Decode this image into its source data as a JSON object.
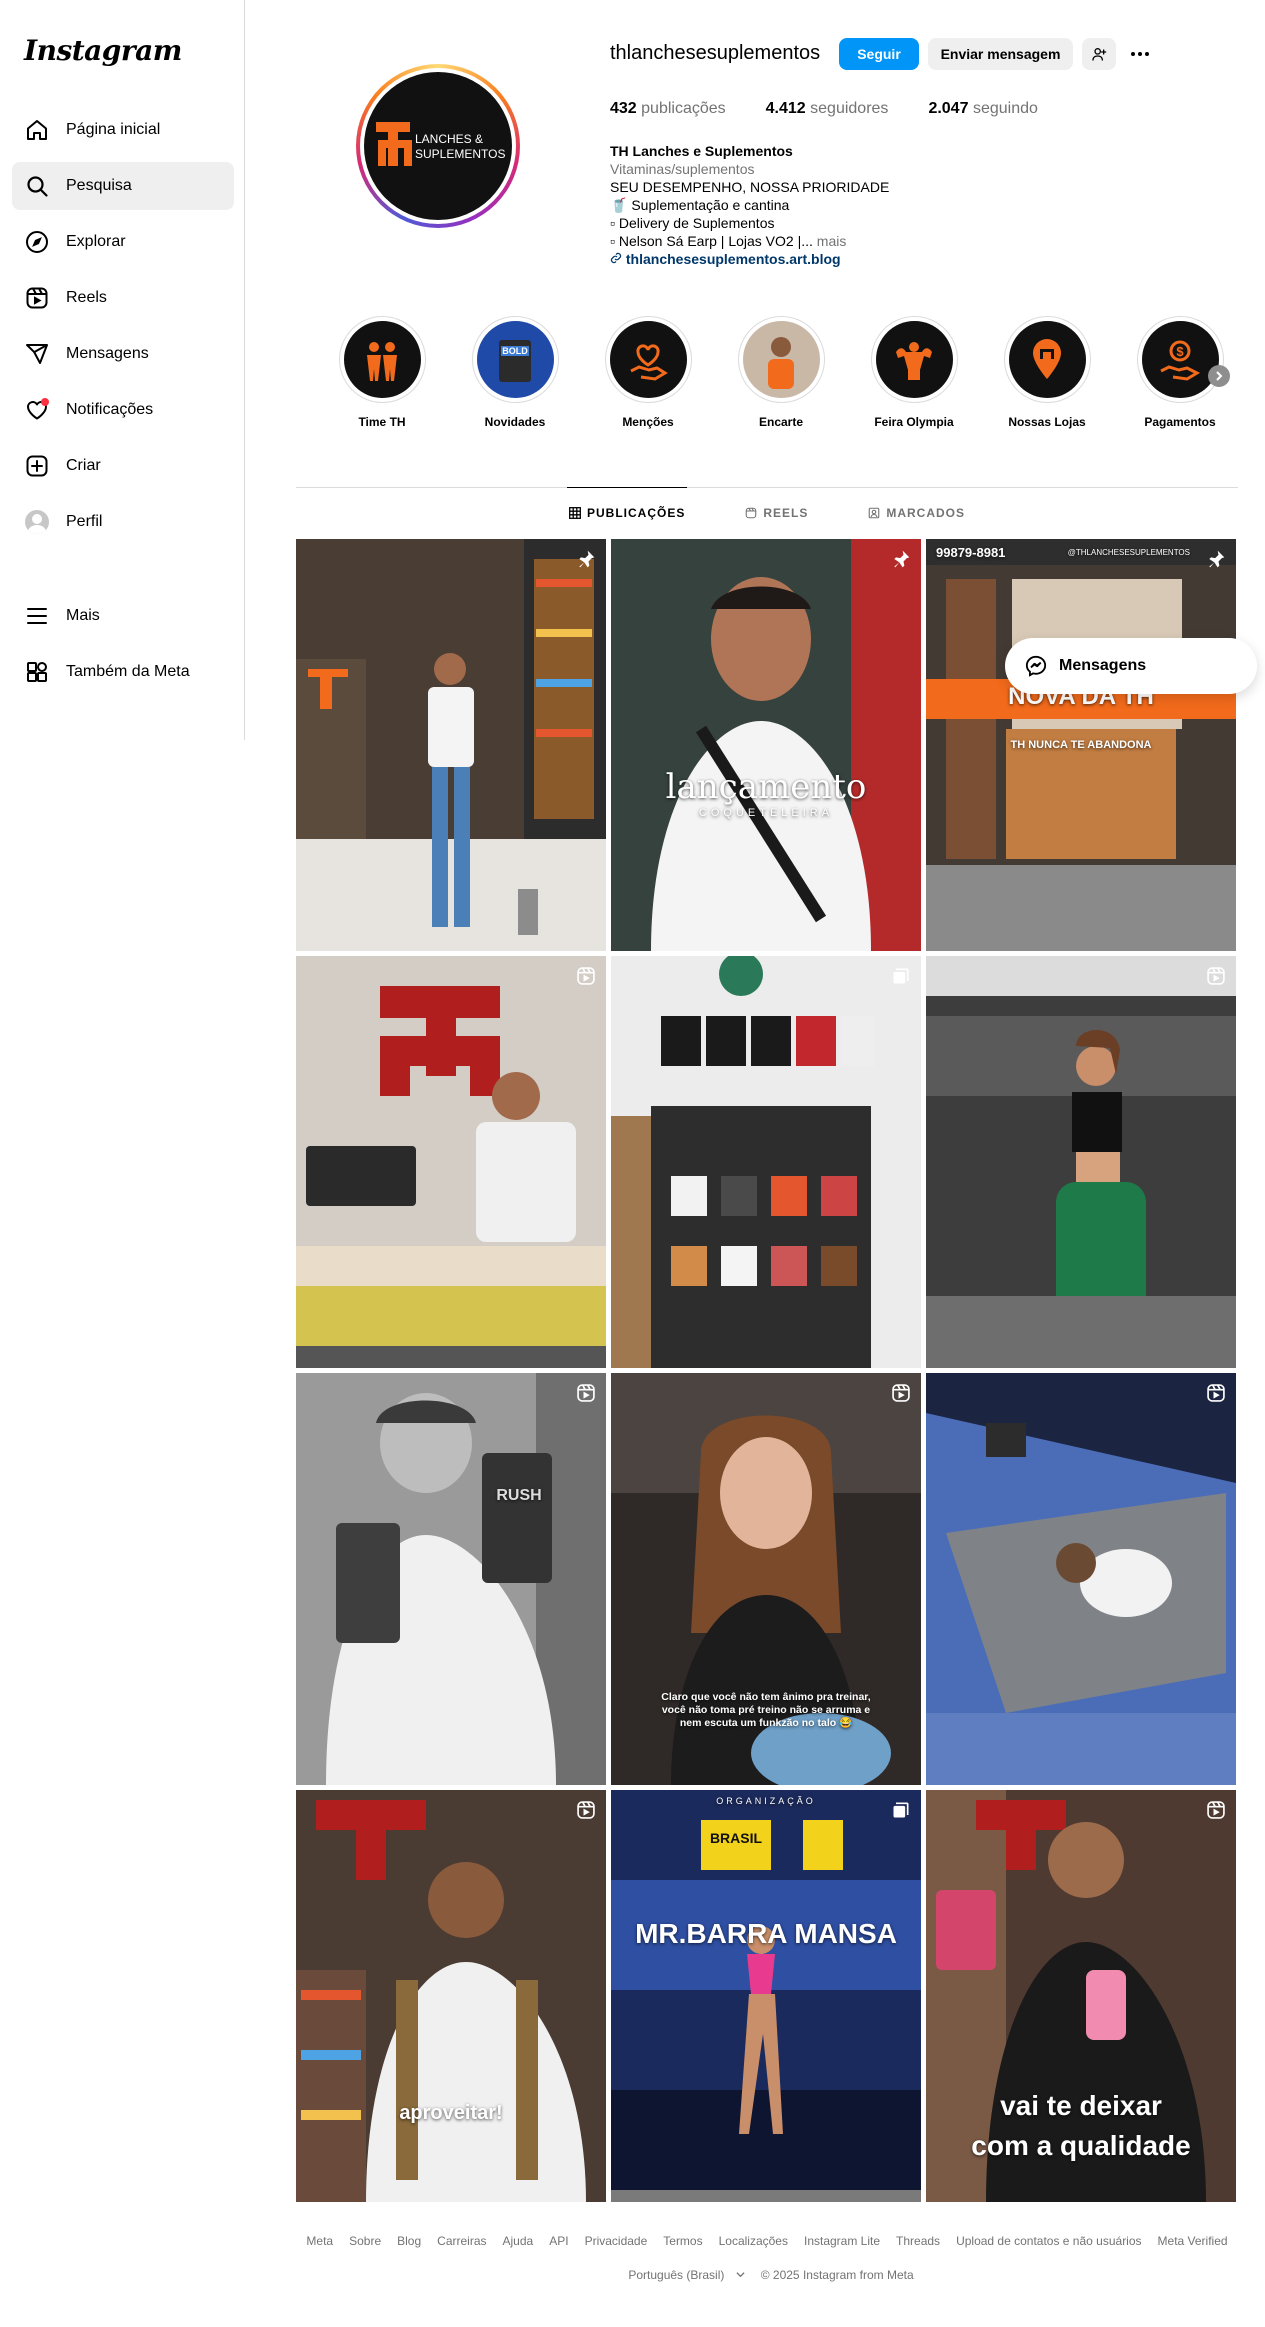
{
  "app": {
    "logo_text": "Instagram"
  },
  "sidebar": {
    "items": [
      {
        "label": "Página inicial",
        "icon": "home-icon"
      },
      {
        "label": "Pesquisa",
        "icon": "search-icon",
        "active": true
      },
      {
        "label": "Explorar",
        "icon": "compass-icon"
      },
      {
        "label": "Reels",
        "icon": "reels-icon"
      },
      {
        "label": "Mensagens",
        "icon": "messages-icon"
      },
      {
        "label": "Notificações",
        "icon": "heart-icon"
      },
      {
        "label": "Criar",
        "icon": "create-icon"
      },
      {
        "label": "Perfil",
        "icon": "avatar"
      }
    ],
    "bottom": [
      {
        "label": "Mais",
        "icon": "menu-icon"
      },
      {
        "label": "Também da Meta",
        "icon": "meta-apps-icon"
      }
    ]
  },
  "profile": {
    "username": "thlanchesesuplementos",
    "follow_label": "Seguir",
    "message_label": "Enviar mensagem",
    "logo_text_1": "LANCHES &",
    "logo_text_2": "SUPLEMENTOS",
    "stats": {
      "posts_count": "432",
      "posts_label": "publicações",
      "followers_count": "4.412",
      "followers_label": "seguidores",
      "following_count": "2.047",
      "following_label": "seguindo"
    },
    "bio": {
      "name": "TH Lanches e Suplementos",
      "category": "Vitaminas/suplementos",
      "line1": "SEU DESEMPENHO, NOSSA PRIORIDADE",
      "line2": "🥤 Suplementação e cantina",
      "line3": "▫ Delivery de Suplementos",
      "line4": "▫ Nelson Sá Earp | Lojas VO2 |...",
      "more": "mais",
      "link": "thlanchesesuplementos.art.blog"
    }
  },
  "highlights": [
    {
      "label": "Time TH"
    },
    {
      "label": "Novidades"
    },
    {
      "label": "Menções"
    },
    {
      "label": "Encarte"
    },
    {
      "label": "Feira Olympia"
    },
    {
      "label": "Nossas Lojas"
    },
    {
      "label": "Pagamentos"
    }
  ],
  "tabs": [
    {
      "label": "PUBLICAÇÕES"
    },
    {
      "label": "REELS"
    },
    {
      "label": "MARCADOS"
    }
  ],
  "posts": [
    {
      "badge": "pin"
    },
    {
      "badge": "pin",
      "caption_big": "lançamento",
      "caption_small": "COQUETELEIRA"
    },
    {
      "badge": "pin",
      "phone": "99879-8981",
      "handle": "@THLANCHESESUPLEMENTOS",
      "banner": "NOVA DA TH",
      "tagline": "TH NUNCA TE ABANDONA"
    },
    {
      "badge": "reel"
    },
    {
      "badge": "carousel"
    },
    {
      "badge": "reel"
    },
    {
      "badge": "reel",
      "can_text": "RUSH"
    },
    {
      "badge": "reel",
      "caption": "Claro que você não tem ânimo pra treinar, você não toma pré treino não se arruma e nem escuta um funkzão no talo 😂"
    },
    {
      "badge": "reel"
    },
    {
      "badge": "reel",
      "caption": "aproveitar!"
    },
    {
      "badge": "carousel",
      "org": "ORGANIZAÇÃO",
      "event": "MR.BARRA MANSA",
      "brand": "BRASIL"
    },
    {
      "badge": "reel",
      "caption_a": "vai te deixar",
      "caption_b": "com a qualidade"
    }
  ],
  "messages_pill": {
    "label": "Mensagens"
  },
  "footer": {
    "links": [
      "Meta",
      "Sobre",
      "Blog",
      "Carreiras",
      "Ajuda",
      "API",
      "Privacidade",
      "Termos",
      "Localizações",
      "Instagram Lite",
      "Threads",
      "Upload de contatos e não usuários",
      "Meta Verified"
    ],
    "language": "Português (Brasil)",
    "copyright": "© 2025 Instagram from Meta"
  },
  "colors": {
    "accent": "#0095f6",
    "brand_orange": "#f26a1b",
    "notification": "#ff3040"
  }
}
